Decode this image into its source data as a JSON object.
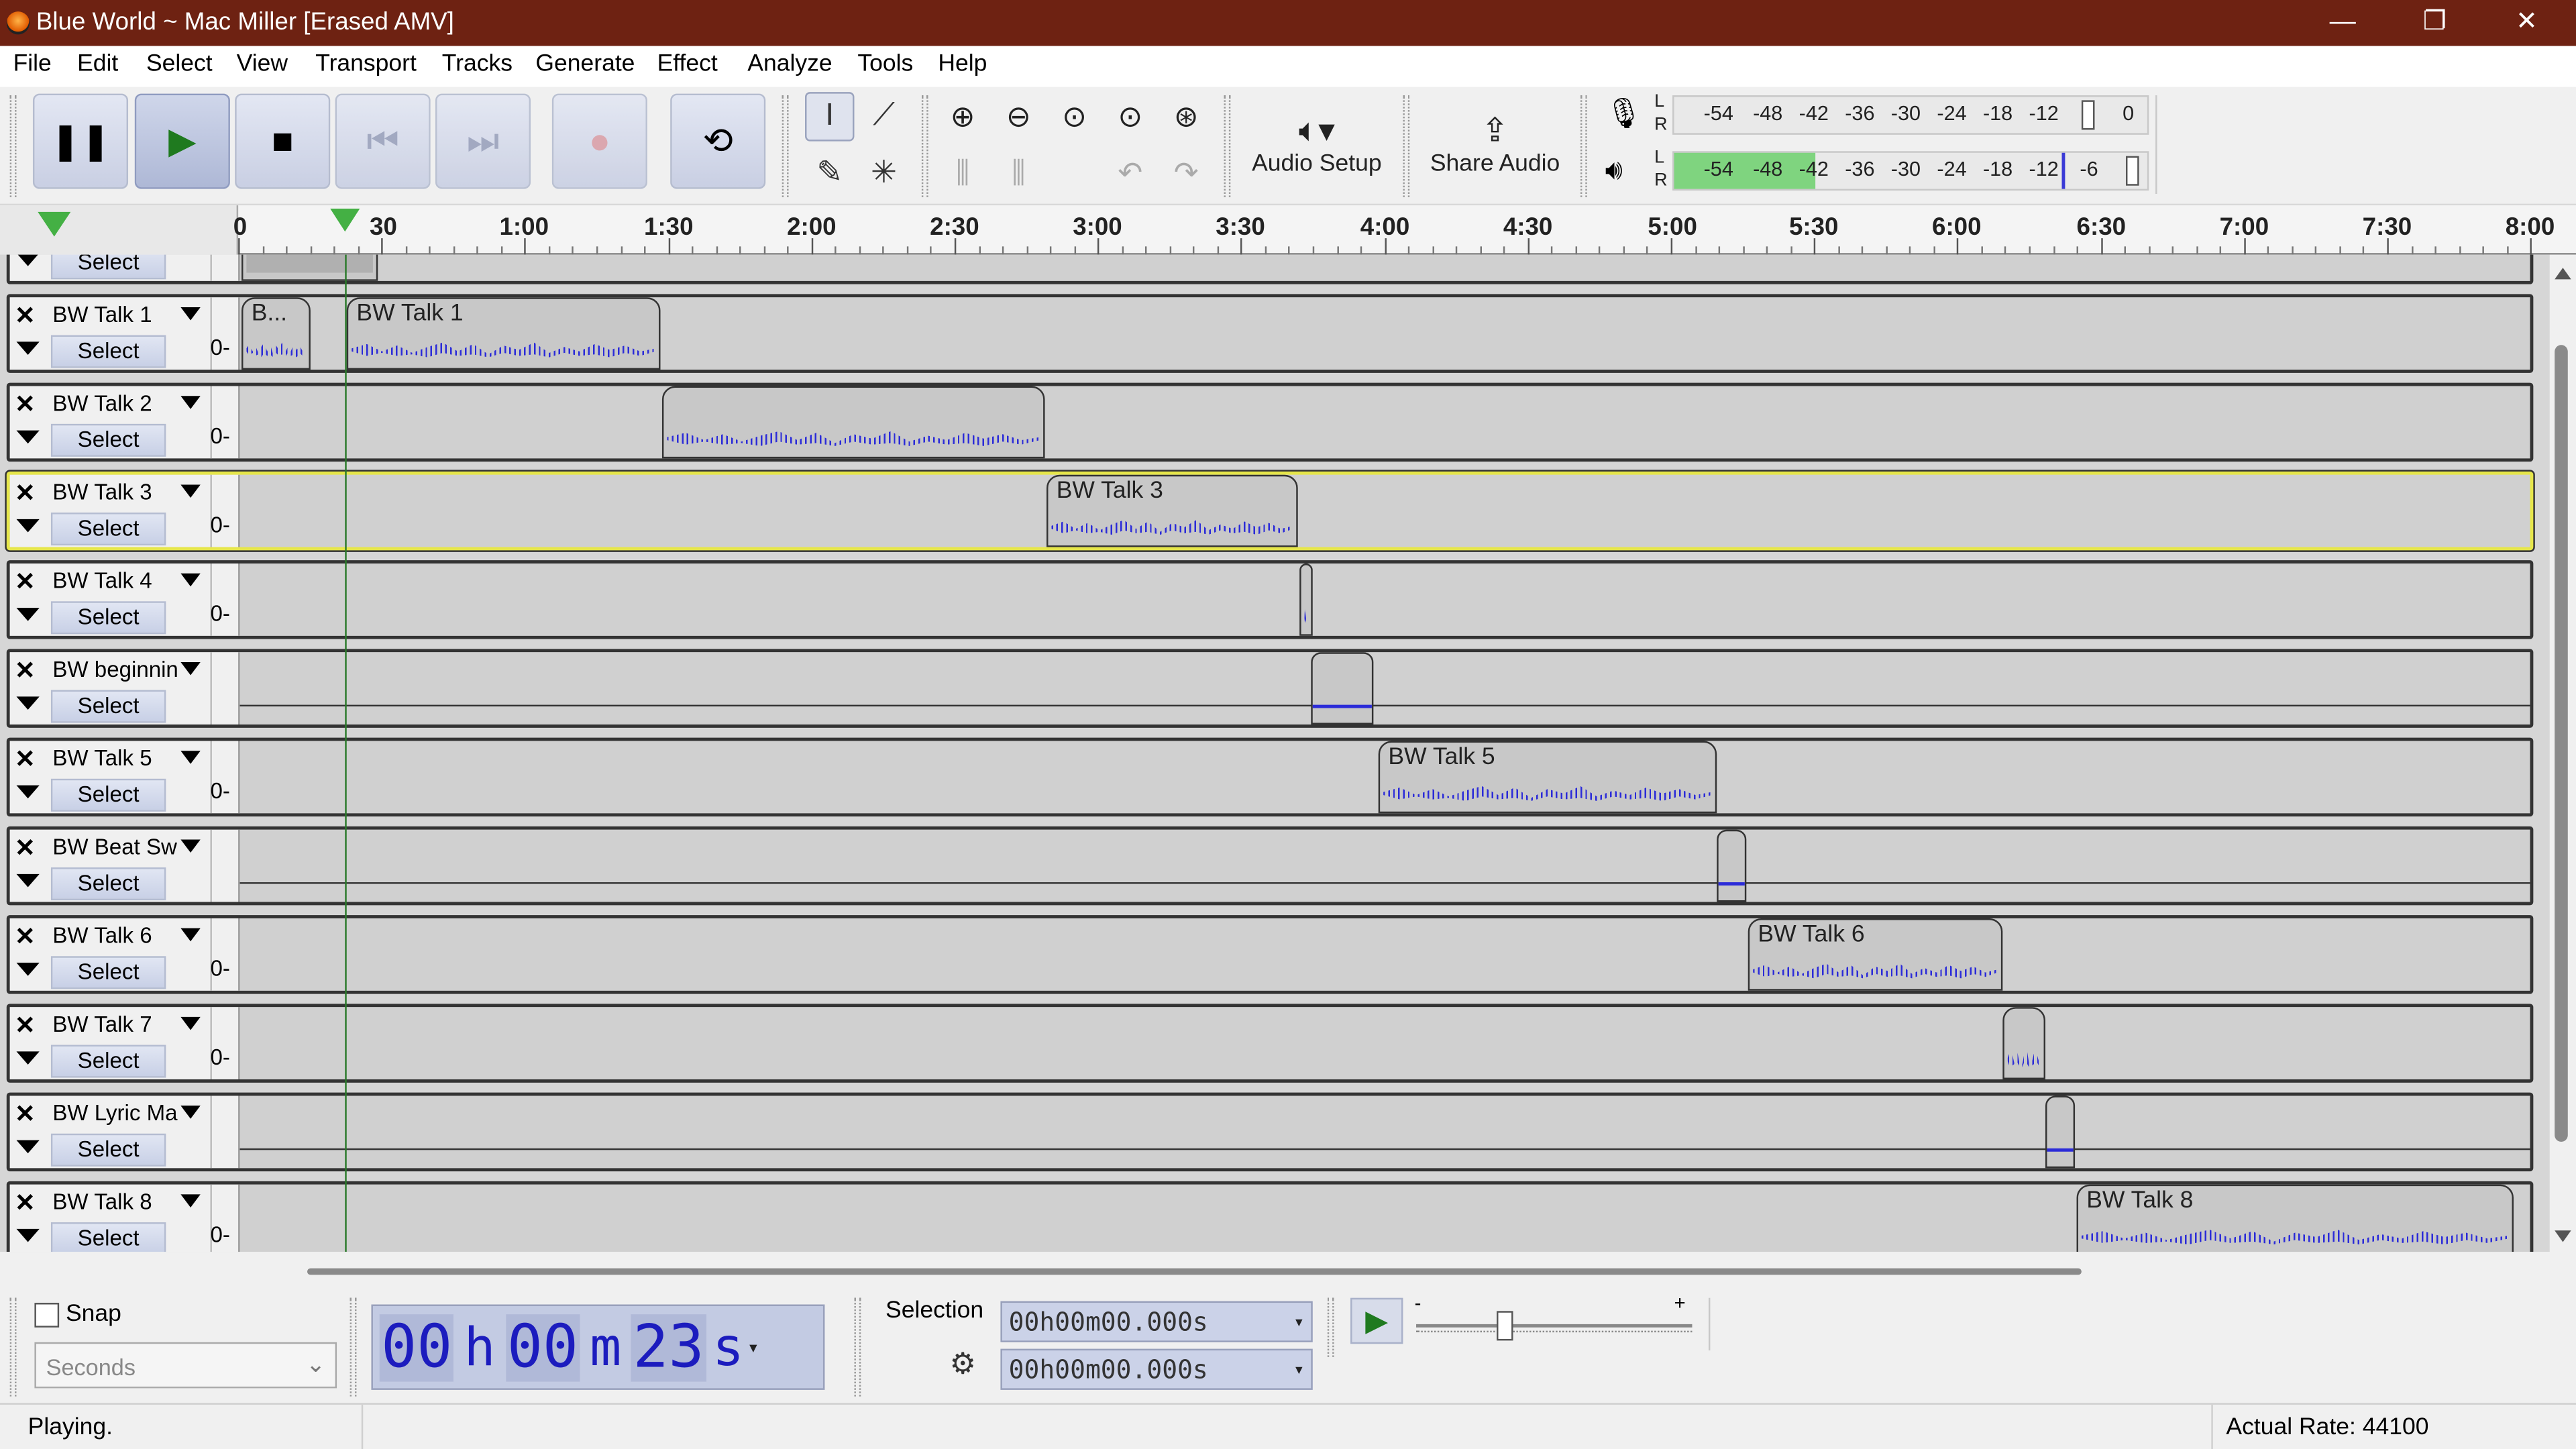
{
  "window": {
    "title": "Blue World ~ Mac Miller [Erased AMV]",
    "controls": [
      "—",
      "❐",
      "✕"
    ]
  },
  "menu": [
    "File",
    "Edit",
    "Select",
    "View",
    "Transport",
    "Tracks",
    "Generate",
    "Effect",
    "Analyze",
    "Tools",
    "Help"
  ],
  "toolbar": {
    "audio_setup_label": "Audio Setup",
    "share_audio_label": "Share Audio",
    "record_meter_scale": [
      "L",
      "R",
      "-54",
      "-48",
      "-42",
      "-36",
      "-30",
      "-24",
      "-18",
      "-12",
      "0"
    ],
    "playback_meter_scale": [
      "L",
      "R",
      "-54",
      "-48",
      "-42",
      "-36",
      "-30",
      "-24",
      "-18",
      "-12",
      "-6"
    ],
    "playback_level": 0.3
  },
  "ruler": {
    "labels": [
      "0",
      "30",
      "1:00",
      "1:30",
      "2:00",
      "2:30",
      "3:00",
      "3:30",
      "4:00",
      "4:30",
      "5:00",
      "5:30",
      "6:00",
      "6:30",
      "7:00",
      "7:30",
      "8:00"
    ]
  },
  "tracks": [
    {
      "name": "",
      "select": "Select",
      "vu": "",
      "clips": [
        {
          "label": ""
        }
      ]
    },
    {
      "name": "BW Talk 1",
      "select": "Select",
      "vu": "0-",
      "clips": [
        {
          "label": "B..."
        },
        {
          "label": "BW Talk 1"
        }
      ]
    },
    {
      "name": "BW Talk 2",
      "select": "Select",
      "vu": "0-",
      "clips": [
        {
          "label": ""
        }
      ]
    },
    {
      "name": "BW Talk 3",
      "select": "Select",
      "vu": "0-",
      "clips": [
        {
          "label": "BW Talk 3"
        }
      ]
    },
    {
      "name": "BW Talk 4",
      "select": "Select",
      "vu": "0-",
      "clips": [
        {
          "label": ""
        }
      ]
    },
    {
      "name": "BW beginnin",
      "select": "Select",
      "vu": "",
      "clips": [
        {
          "label": ""
        }
      ]
    },
    {
      "name": "BW Talk 5",
      "select": "Select",
      "vu": "0-",
      "clips": [
        {
          "label": "BW Talk 5"
        }
      ]
    },
    {
      "name": "BW Beat Sw",
      "select": "Select",
      "vu": "",
      "clips": [
        {
          "label": ""
        }
      ]
    },
    {
      "name": "BW Talk 6",
      "select": "Select",
      "vu": "0-",
      "clips": [
        {
          "label": "BW Talk 6"
        }
      ]
    },
    {
      "name": "BW Talk 7",
      "select": "Select",
      "vu": "0-",
      "clips": [
        {
          "label": ""
        }
      ]
    },
    {
      "name": "BW Lyric Ma",
      "select": "Select",
      "vu": "",
      "clips": [
        {
          "label": ""
        }
      ]
    },
    {
      "name": "BW Talk 8",
      "select": "Select",
      "vu": "0-",
      "clips": [
        {
          "label": "BW Talk 8"
        }
      ]
    }
  ],
  "bottom": {
    "snap_label": "Snap",
    "snap_checked": false,
    "snap_unit": "Seconds",
    "time": {
      "h": "00",
      "h_unit": "h",
      "m": "00",
      "m_unit": "m",
      "s": "23",
      "s_unit": "s"
    },
    "selection_label": "Selection",
    "selection_start": "00h00m00.000s",
    "selection_end": "00h00m00.000s",
    "speed_min": "-",
    "speed_max": "+"
  },
  "status": {
    "left": "Playing.",
    "right": "Actual Rate: 44100"
  }
}
